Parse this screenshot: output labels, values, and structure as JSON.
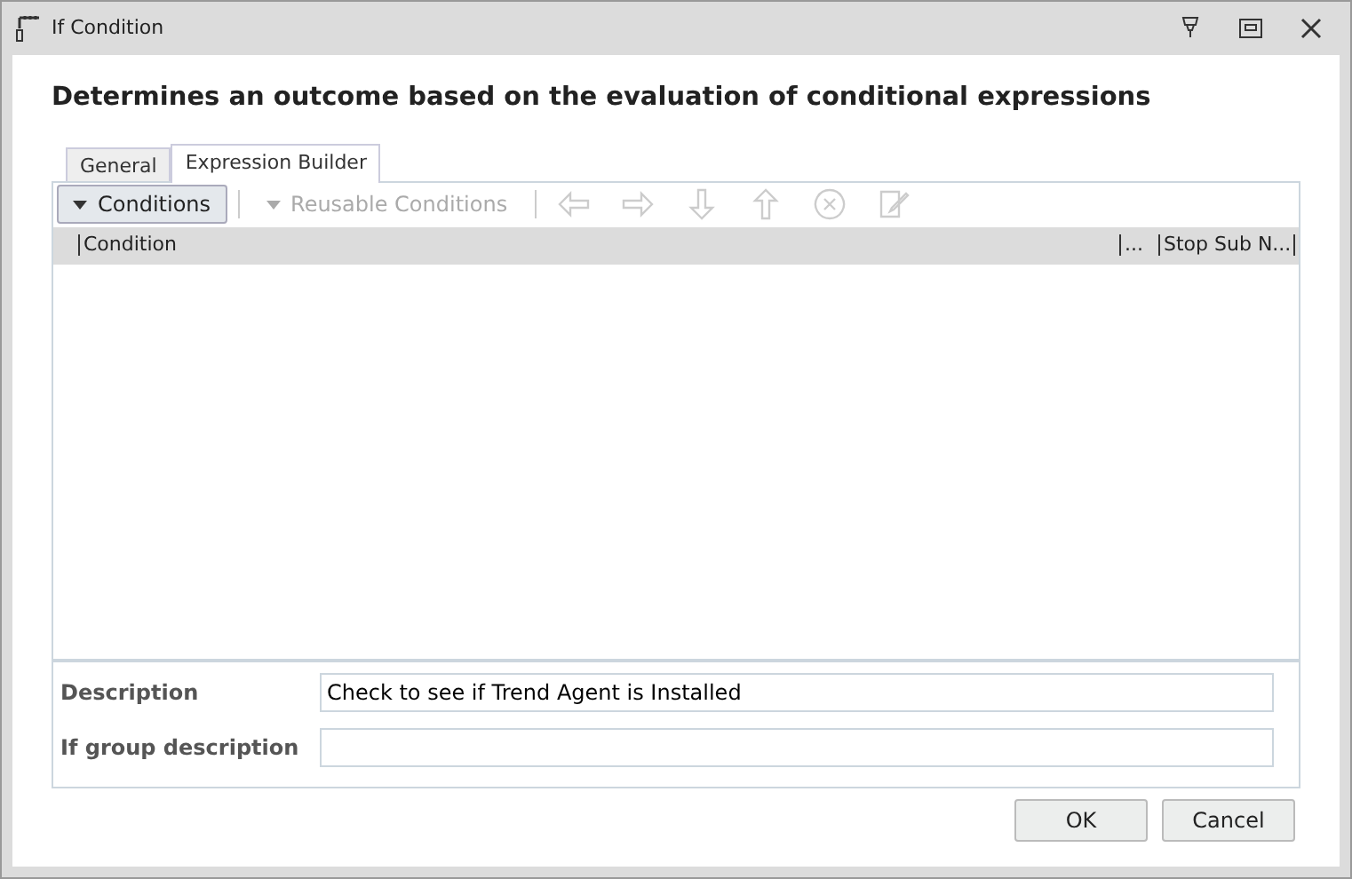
{
  "window": {
    "title": "If Condition"
  },
  "heading": "Determines an outcome based on the evaluation of conditional expressions",
  "tabs": [
    {
      "label": "General",
      "selected": false
    },
    {
      "label": "Expression Builder",
      "selected": true
    }
  ],
  "toolbar": [
    {
      "kind": "dropdown",
      "label": "Conditions",
      "disabled": false
    },
    {
      "kind": "dropdown",
      "label": "Reusable Conditions",
      "disabled": true
    },
    {
      "kind": "left",
      "disabled": true
    },
    {
      "kind": "right",
      "disabled": true
    },
    {
      "kind": "down",
      "disabled": true
    },
    {
      "kind": "up",
      "disabled": true
    },
    {
      "kind": "remove",
      "disabled": true
    },
    {
      "kind": "edit",
      "disabled": true
    }
  ],
  "table": {
    "columns": [
      "Condition",
      "...",
      "Stop Sub N..."
    ]
  },
  "fields": [
    {
      "label": "Description",
      "value": "Check to see if Trend Agent is Installed"
    },
    {
      "label": "If group description"
    }
  ],
  "buttons": [
    "OK",
    "Cancel"
  ]
}
